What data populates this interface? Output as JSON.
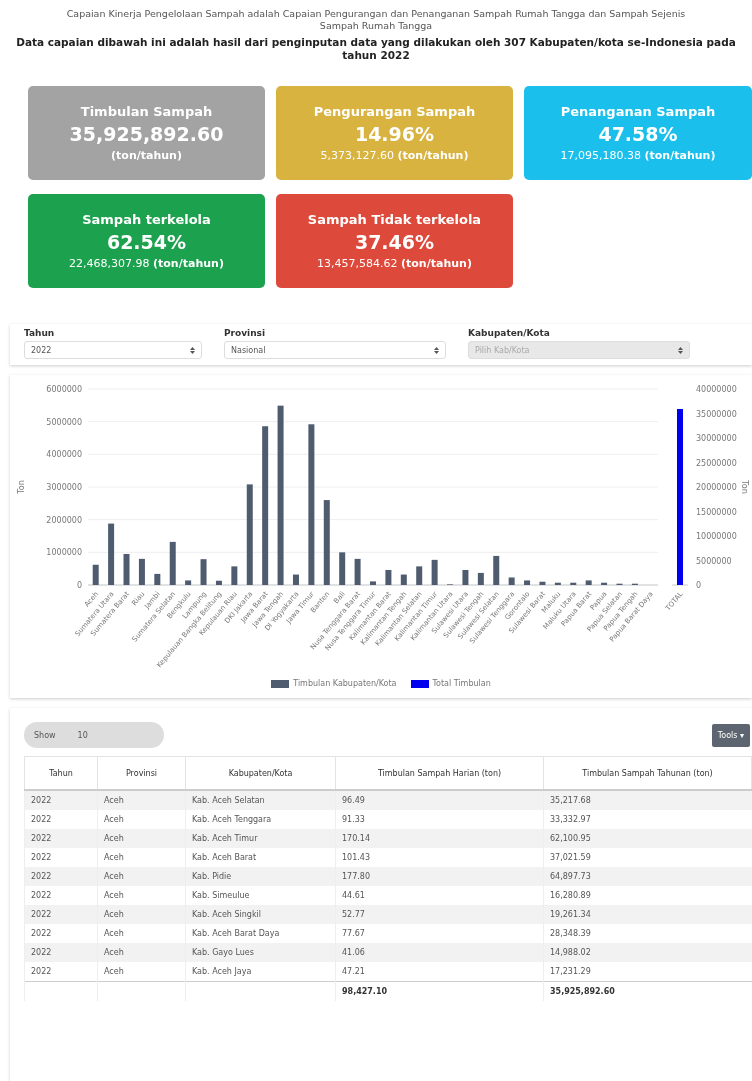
{
  "intro": {
    "text": "Capaian Kinerja Pengelolaan Sampah adalah Capaian Pengurangan dan Penanganan Sampah Rumah Tangga dan Sampah Sejenis Sampah Rumah Tangga",
    "note": "Data capaian dibawah ini adalah hasil dari penginputan data yang dilakukan oleh 307 Kabupaten/kota se-Indonesia pada tahun 2022"
  },
  "cards": [
    {
      "title": "Timbulan Sampah",
      "value": "35,925,892.60",
      "unit": "(ton/tahun)",
      "color": "#a3a3a3"
    },
    {
      "title": "Pengurangan Sampah",
      "value": "14.96%",
      "amount": "5,373,127.60",
      "unit": "(ton/tahun)",
      "color": "#d8b33f"
    },
    {
      "title": "Penanganan Sampah",
      "value": "47.58%",
      "amount": "17,095,180.38",
      "unit": "(ton/tahun)",
      "color": "#1bbfec"
    },
    {
      "title": "Sampah terkelola",
      "value": "62.54%",
      "amount": "22,468,307.98",
      "unit": "(ton/tahun)",
      "color": "#1ca24e"
    },
    {
      "title": "Sampah Tidak terkelola",
      "value": "37.46%",
      "amount": "13,457,584.62",
      "unit": "(ton/tahun)",
      "color": "#dd4a3b"
    }
  ],
  "filters": [
    {
      "label": "Tahun",
      "value": "2022",
      "disabled": false
    },
    {
      "label": "Provinsi",
      "value": "Nasional",
      "disabled": false
    },
    {
      "label": "Kabupaten/Kota",
      "placeholder": "Pilih Kab/Kota",
      "disabled": true
    }
  ],
  "chart": {
    "chart_data": {
      "type": "bar",
      "ylabel": "Ton",
      "grid": true,
      "categories": [
        "Aceh",
        "Sumatera Utara",
        "Sumatera Barat",
        "Riau",
        "Jambi",
        "Sumatera Selatan",
        "Bengkulu",
        "Lampung",
        "Kepulauan Bangka Belitung",
        "Kepulauan Riau",
        "DKI Jakarta",
        "Jawa Barat",
        "Jawa Tengah",
        "DI Yogyakarta",
        "Jawa Timur",
        "Banten",
        "Bali",
        "Nusa Tenggara Barat",
        "Nusa Tenggara Timur",
        "Kalimantan Barat",
        "Kalimantan Tengah",
        "Kalimantan Selatan",
        "Kalimantan Timur",
        "Kalimantan Utara",
        "Sulawesi Utara",
        "Sulawesi Tengah",
        "Sulawesi Selatan",
        "Sulawesi Tenggara",
        "Gorontalo",
        "Sulawesi Barat",
        "Maluku",
        "Maluku Utara",
        "Papua Barat",
        "Papua",
        "Papua Selatan",
        "Papua Tengah",
        "Papua Barat Daya"
      ],
      "series": [
        {
          "name": "Timbulan Kabupaten/Kota",
          "color": "#4f5b6e",
          "values": [
            620000,
            1880000,
            950000,
            800000,
            340000,
            1320000,
            140000,
            790000,
            130000,
            570000,
            3080000,
            4860000,
            5490000,
            320000,
            4920000,
            2600000,
            1000000,
            800000,
            110000,
            460000,
            320000,
            570000,
            770000,
            20000,
            460000,
            370000,
            890000,
            230000,
            140000,
            100000,
            70000,
            70000,
            140000,
            70000,
            40000,
            40000,
            null
          ]
        }
      ],
      "ylim": [
        0,
        6000000
      ],
      "yticks": [
        0,
        1000000,
        2000000,
        3000000,
        4000000,
        5000000,
        6000000
      ]
    },
    "total_chart": {
      "chart_data": {
        "type": "bar",
        "ylabel": "Ton",
        "categories": [
          "TOTAL"
        ],
        "series": [
          {
            "name": "Total Timbulan",
            "color": "#0000ee",
            "values": [
              35925892.6
            ]
          }
        ],
        "ylim": [
          0,
          40000000
        ],
        "yticks": [
          0,
          5000000,
          10000000,
          15000000,
          20000000,
          25000000,
          30000000,
          35000000,
          40000000
        ]
      }
    }
  },
  "table": {
    "show_label": "Show",
    "page_size": "10",
    "tools": "Tools ▾",
    "columns": [
      "Tahun",
      "Provinsi",
      "Kabupaten/Kota",
      "Timbulan Sampah Harian (ton)",
      "Timbulan Sampah Tahunan (ton)"
    ],
    "rows": [
      [
        "2022",
        "Aceh",
        "Kab. Aceh Selatan",
        "96.49",
        "35,217.68"
      ],
      [
        "2022",
        "Aceh",
        "Kab. Aceh Tenggara",
        "91.33",
        "33,332.97"
      ],
      [
        "2022",
        "Aceh",
        "Kab. Aceh Timur",
        "170.14",
        "62,100.95"
      ],
      [
        "2022",
        "Aceh",
        "Kab. Aceh Barat",
        "101.43",
        "37,021.59"
      ],
      [
        "2022",
        "Aceh",
        "Kab. Pidie",
        "177.80",
        "64,897.73"
      ],
      [
        "2022",
        "Aceh",
        "Kab. Simeulue",
        "44.61",
        "16,280.89"
      ],
      [
        "2022",
        "Aceh",
        "Kab. Aceh Singkil",
        "52.77",
        "19,261.34"
      ],
      [
        "2022",
        "Aceh",
        "Kab. Aceh Barat Daya",
        "77.67",
        "28,348.39"
      ],
      [
        "2022",
        "Aceh",
        "Kab. Gayo Lues",
        "41.06",
        "14,988.02"
      ],
      [
        "2022",
        "Aceh",
        "Kab. Aceh Jaya",
        "47.21",
        "17,231.29"
      ]
    ],
    "totals": [
      "98,427.10",
      "35,925,892.60"
    ]
  }
}
